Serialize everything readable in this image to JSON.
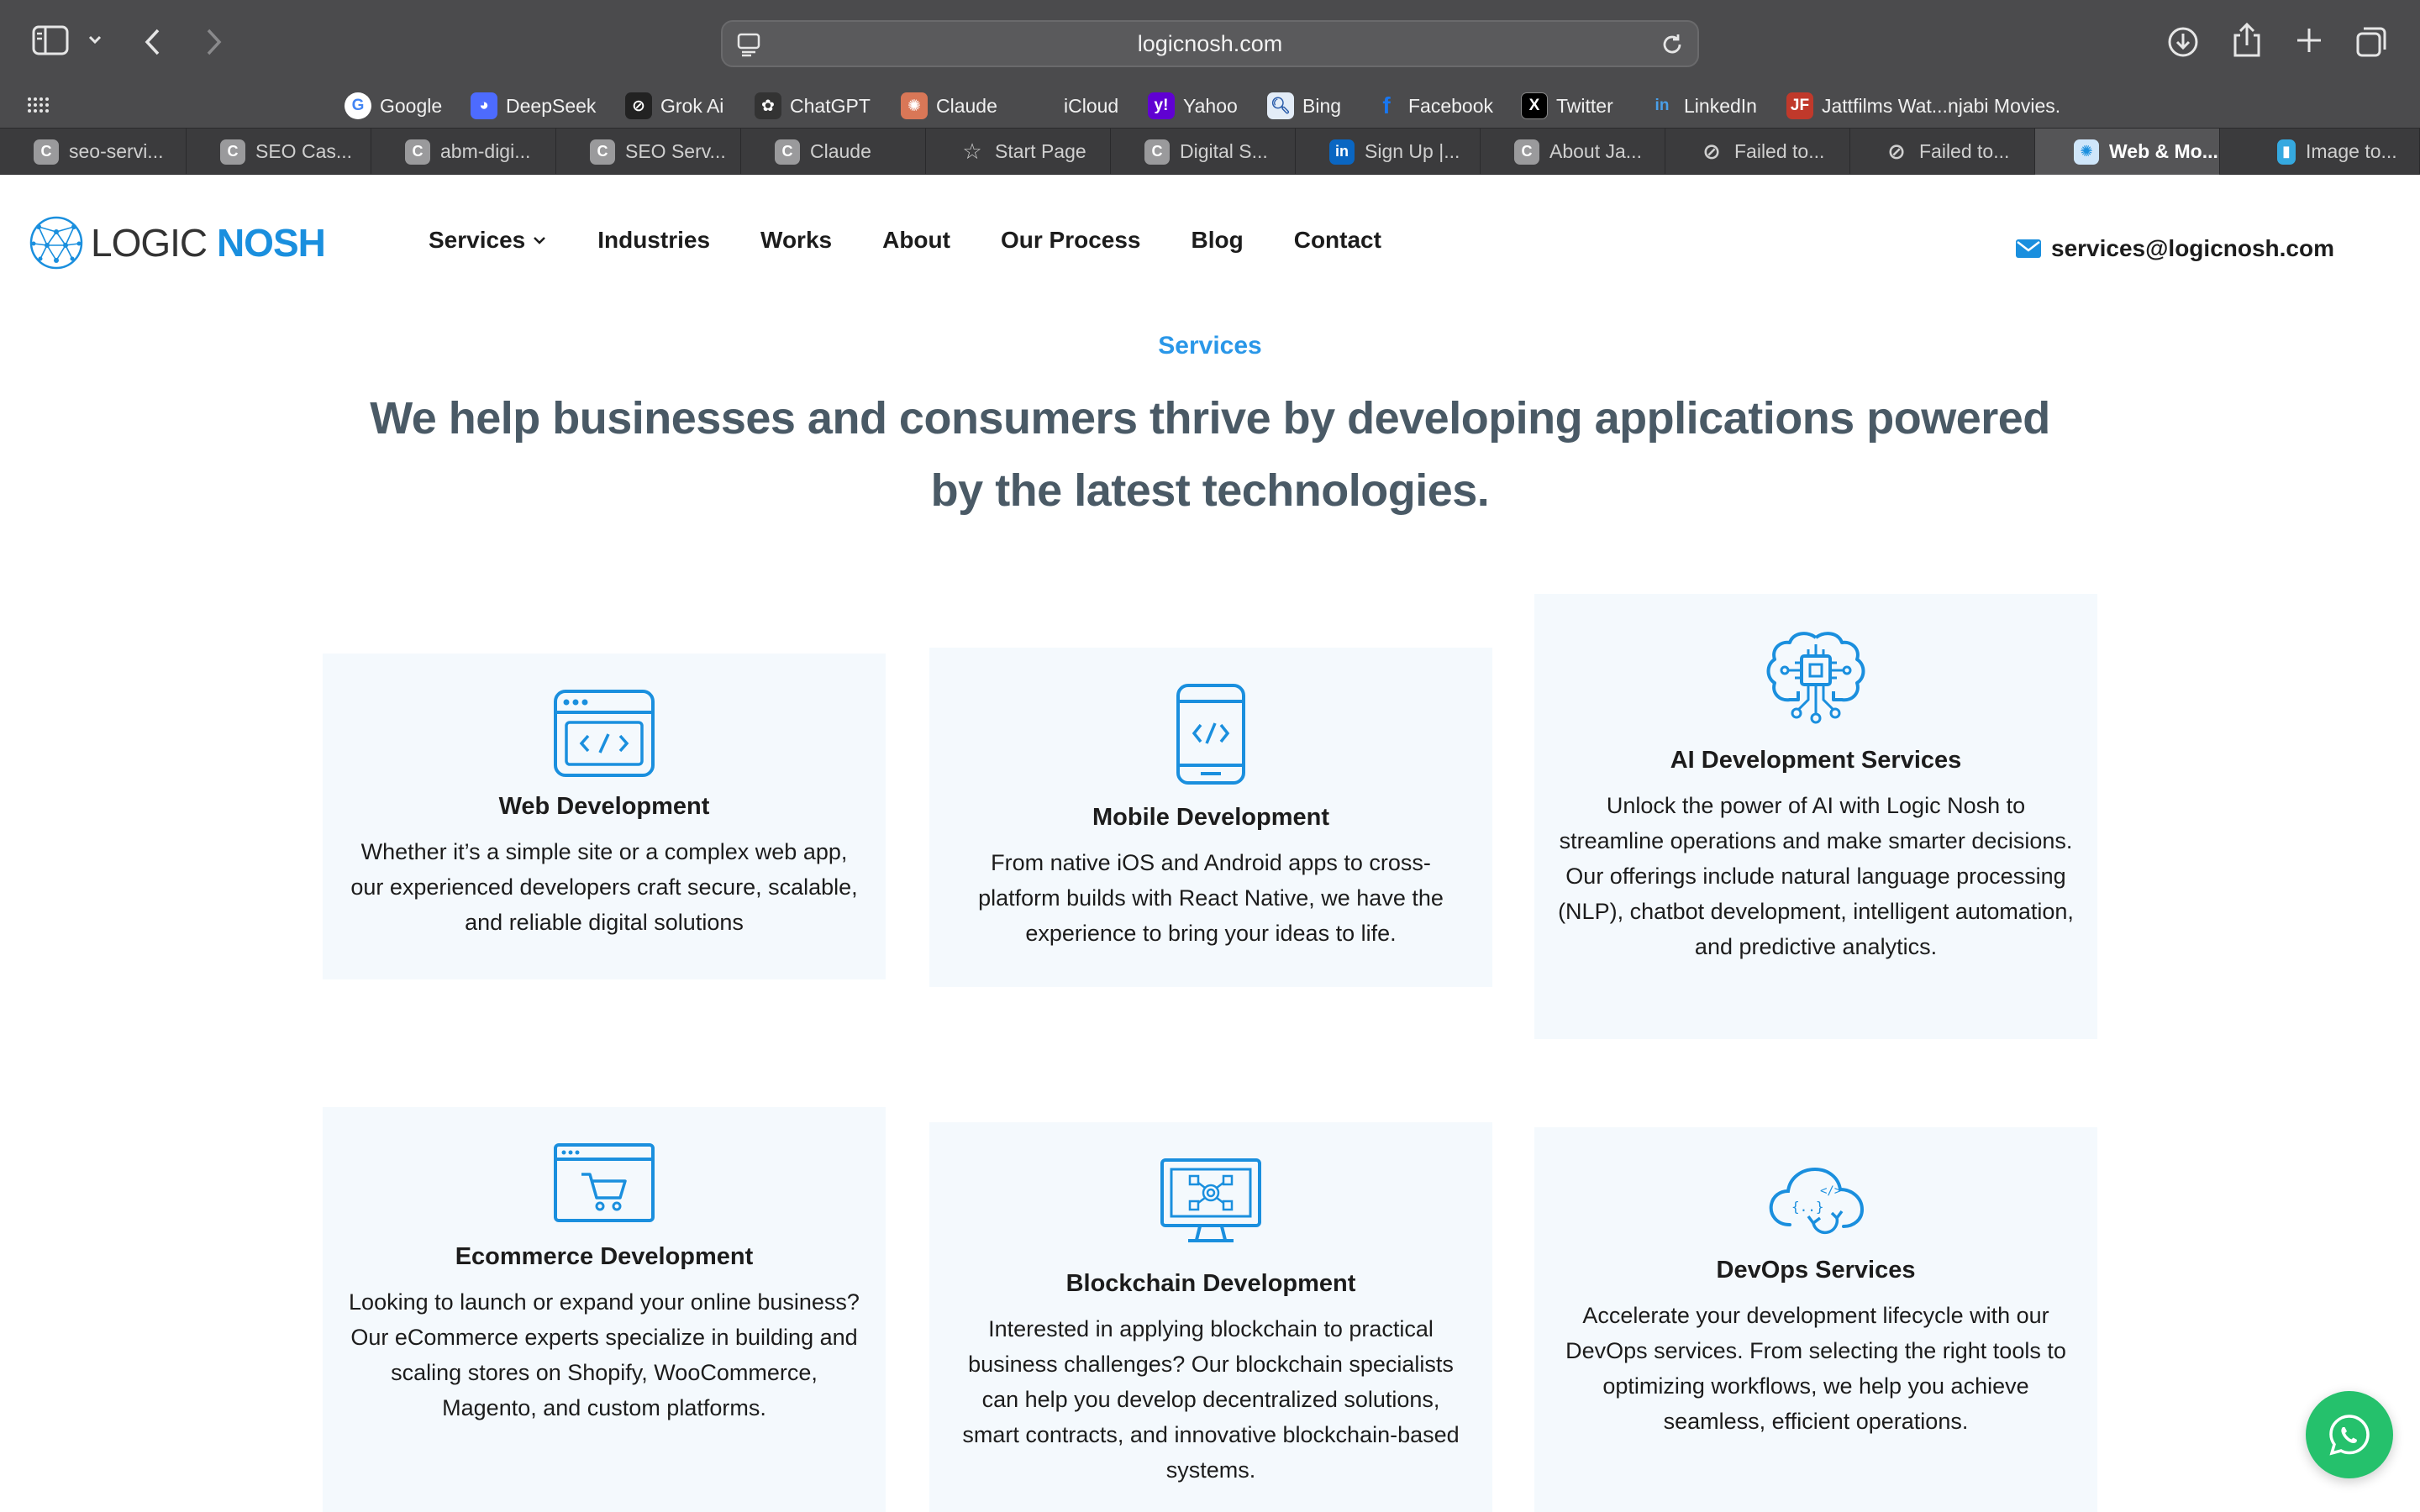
{
  "browser": {
    "url": "logicnosh.com",
    "bookmarks": [
      {
        "label": "Google",
        "icon": "google-icon",
        "color": "#ffffff"
      },
      {
        "label": "DeepSeek",
        "icon": "deepseek-icon",
        "color": "#4d6bfe"
      },
      {
        "label": "Grok Ai",
        "icon": "grok-icon",
        "color": "#222222"
      },
      {
        "label": "ChatGPT",
        "icon": "chatgpt-icon",
        "color": "#333333"
      },
      {
        "label": "Claude",
        "icon": "claude-icon",
        "color": "#d97757"
      },
      {
        "label": "iCloud",
        "icon": "apple-icon",
        "color": "#4b4b4d"
      },
      {
        "label": "Yahoo",
        "icon": "yahoo-icon",
        "color": "#6001d2"
      },
      {
        "label": "Bing",
        "icon": "bing-icon",
        "color": "#e3ecf7"
      },
      {
        "label": "Facebook",
        "icon": "facebook-icon",
        "color": "#1877f2"
      },
      {
        "label": "Twitter",
        "icon": "x-icon",
        "color": "#000000"
      },
      {
        "label": "LinkedIn",
        "icon": "linkedin-icon",
        "color": "#0a66c2"
      },
      {
        "label": "Jattfilms Wat...njabi Movies.",
        "icon": "jattfilms-icon",
        "color": "#c0392b"
      }
    ],
    "tabs": [
      {
        "label": "seo-servi...",
        "fav": "C"
      },
      {
        "label": "SEO Cas...",
        "fav": "C"
      },
      {
        "label": "abm-digi...",
        "fav": "C"
      },
      {
        "label": "SEO Serv...",
        "fav": "C"
      },
      {
        "label": "Claude",
        "fav": "C"
      },
      {
        "label": "Start Page",
        "fav": "☆"
      },
      {
        "label": "Digital S...",
        "fav": "C"
      },
      {
        "label": "Sign Up |...",
        "fav": "in"
      },
      {
        "label": "About Ja...",
        "fav": "C"
      },
      {
        "label": "Failed to...",
        "fav": "⊘"
      },
      {
        "label": "Failed to...",
        "fav": "⊘"
      },
      {
        "label": "Web & Mo...",
        "fav": "✺",
        "active": true
      },
      {
        "label": "Image to...",
        "fav": "▮"
      }
    ]
  },
  "site": {
    "logo": {
      "part1": "LOGIC ",
      "part2": "NOSH"
    },
    "nav": [
      "Services",
      "Industries",
      "Works",
      "About",
      "Our Process",
      "Blog",
      "Contact"
    ],
    "email": "services@logicnosh.com",
    "accent": "#1a8fde"
  },
  "section": {
    "eyebrow": "Services",
    "headline_line1": "We help businesses and consumers thrive by developing applications powered",
    "headline_line2": "by the latest technologies."
  },
  "services": [
    {
      "title": "Web Development",
      "icon": "code-window-icon",
      "desc": "Whether it’s a simple site or a complex web app, our experienced developers craft secure, scalable, and reliable digital solutions"
    },
    {
      "title": "Mobile Development",
      "icon": "mobile-code-icon",
      "desc": "From native iOS and Android apps to cross-platform builds with React Native, we have the experience to bring your ideas to life."
    },
    {
      "title": "AI Development Services",
      "icon": "ai-brain-icon",
      "desc": "Unlock the power of AI with Logic Nosh to streamline operations and make smarter decisions. Our offerings include natural language processing (NLP), chatbot development, intelligent automation, and predictive analytics."
    },
    {
      "title": "Ecommerce Development",
      "icon": "shopping-cart-window-icon",
      "desc": "Looking to launch or expand your online business? Our eCommerce experts specialize in building and scaling stores on Shopify, WooCommerce, Magento, and custom platforms."
    },
    {
      "title": "Blockchain Development",
      "icon": "blockchain-monitor-icon",
      "desc": "Interested in applying blockchain to practical business challenges? Our blockchain specialists can help you develop decentralized solutions, smart contracts, and innovative blockchain-based systems."
    },
    {
      "title": "DevOps Services",
      "icon": "cloud-devops-icon",
      "desc": "Accelerate your development lifecycle with our DevOps services. From selecting the right tools to optimizing workflows, we help you achieve seamless, efficient operations."
    }
  ]
}
